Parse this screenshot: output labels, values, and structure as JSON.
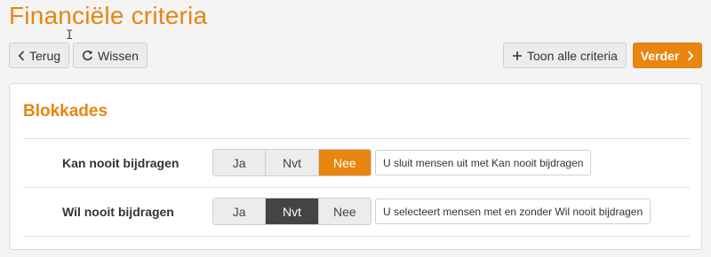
{
  "header": {
    "title": "Financiële criteria"
  },
  "toolbar": {
    "back_label": "Terug",
    "clear_label": "Wissen",
    "show_all_label": "Toon alle criteria",
    "next_label": "Verder"
  },
  "section": {
    "title": "Blokkades",
    "rows": [
      {
        "label": "Kan nooit bijdragen",
        "options": [
          "Ja",
          "Nvt",
          "Nee"
        ],
        "selected": "Nee",
        "hint": "U sluit mensen uit met Kan nooit bijdragen"
      },
      {
        "label": "Wil nooit bijdragen",
        "options": [
          "Ja",
          "Nvt",
          "Nee"
        ],
        "selected": "Nvt",
        "hint": "U selecteert mensen met en zonder Wil nooit bijdragen"
      }
    ]
  },
  "colors": {
    "accent": "#e8860f",
    "selected_dark": "#444444",
    "background": "#f4f4f4"
  },
  "icons": {
    "back": "chevron-left-icon",
    "clear": "refresh-icon",
    "show_all": "plus-icon",
    "next": "chevron-right-icon",
    "cursor": "text-cursor-icon"
  }
}
